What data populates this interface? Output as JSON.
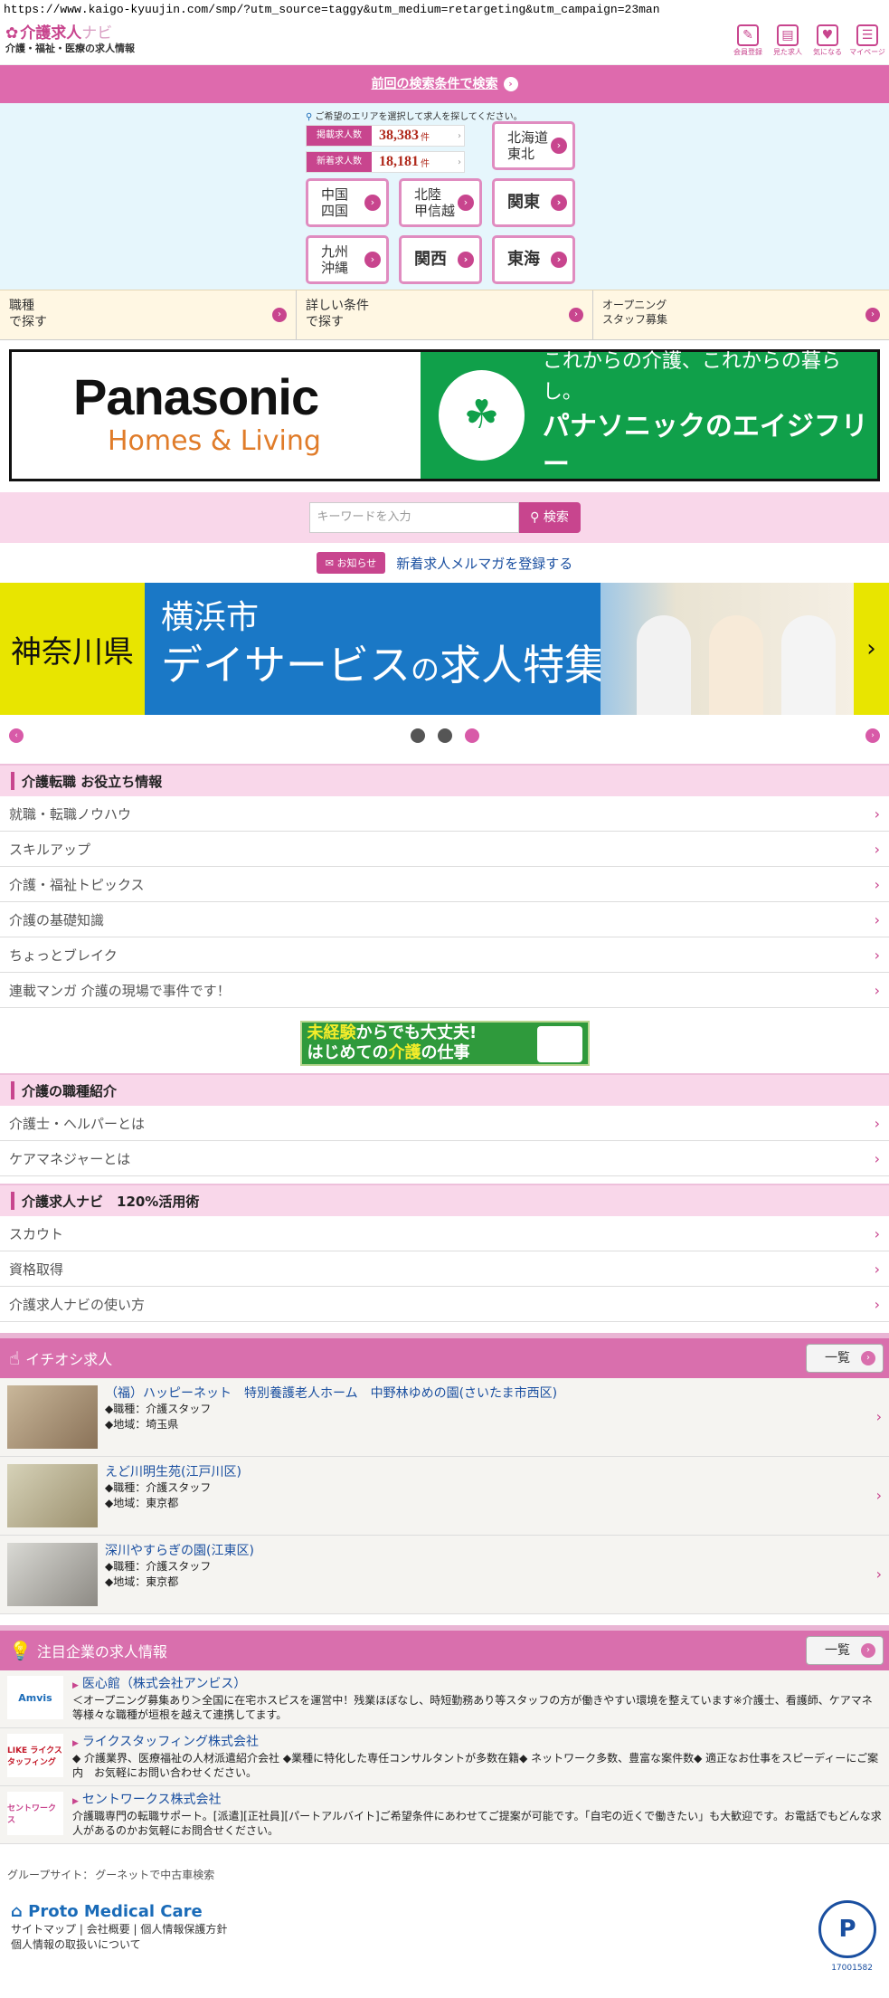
{
  "url": "https://www.kaigo-kyuujin.com/smp/?utm_source=taggy&utm_medium=retargeting&utm_campaign=23man",
  "header": {
    "logo_main": "介護求人",
    "logo_sub": "ナビ",
    "logo_tagline": "介護・福祉・医療の求人情報",
    "icons": [
      {
        "label": "会員登録",
        "icon": "pencil-icon"
      },
      {
        "label": "見た求人",
        "icon": "calendar-icon"
      },
      {
        "label": "気になる",
        "icon": "heart-icon"
      },
      {
        "label": "マイページ",
        "icon": "list-icon"
      }
    ]
  },
  "prev_search": "前回の検索条件で検索",
  "area": {
    "hint": "ご希望のエリアを選択して求人を探してください。",
    "stats": [
      {
        "label": "掲載求人数",
        "value": "38,383",
        "unit": "件"
      },
      {
        "label": "新着求人数",
        "value": "18,181",
        "unit": "件"
      }
    ],
    "regions": [
      "北海道\n東北",
      "中国\n四国",
      "北陸\n甲信越",
      "関東",
      "九州\n沖縄",
      "関西",
      "東海"
    ]
  },
  "search_tabs": [
    "職種\nで探す",
    "詳しい条件\nで探す",
    "オープニング\nスタッフ募集"
  ],
  "ad_banner": {
    "brand": "Panasonic",
    "brand_sub": "Homes & Living",
    "line1": "これからの介護、これからの暮らし。",
    "line2": "パナソニックのエイジフリー"
  },
  "keyword": {
    "placeholder": "キーワードを入力",
    "button": "検索"
  },
  "notice": {
    "tag": "お知らせ",
    "link": "新着求人メルマガを登録する"
  },
  "slide": {
    "left": "神奈川県",
    "title1": "横浜市",
    "title2a": "デイサービス",
    "title2b": "の",
    "title2c": "求人特集"
  },
  "sections": [
    {
      "title": "介護転職 お役立ち情報",
      "items": [
        "就職・転職ノウハウ",
        "スキルアップ",
        "介護・福祉トピックス",
        "介護の基礎知識",
        "ちょっとブレイク",
        "連載マンガ 介護の現場で事件です！"
      ]
    },
    {
      "title": "介護の職種紹介",
      "items": [
        "介護士・ヘルパーとは",
        "ケアマネジャーとは"
      ]
    },
    {
      "title": "介護求人ナビ　120%活用術",
      "items": [
        "スカウト",
        "資格取得",
        "介護求人ナビの使い方"
      ]
    }
  ],
  "mid_banner": {
    "a": "未経験",
    "b": "からでも大丈夫!",
    "c": "はじめての",
    "d": "介護",
    "e": "の仕事"
  },
  "pickup": {
    "title": "イチオシ求人",
    "all": "一覧",
    "jobs": [
      {
        "name": "（福）ハッピーネット　特別養護老人ホーム　中野林ゆめの園(さいたま市西区)",
        "role": "◆職種：介護スタッフ",
        "area": "◆地域：埼玉県"
      },
      {
        "name": "えど川明生苑(江戸川区)",
        "role": "◆職種：介護スタッフ",
        "area": "◆地域：東京都"
      },
      {
        "name": "深川やすらぎの園(江東区)",
        "role": "◆職種：介護スタッフ",
        "area": "◆地域：東京都"
      }
    ]
  },
  "featured": {
    "title": "注目企業の求人情報",
    "all": "一覧",
    "companies": [
      {
        "logo": "Amvis",
        "name": "医心館（株式会社アンビス）",
        "desc": "＜オープニング募集あり＞全国に在宅ホスピスを運営中！残業ほぼなし、時短勤務あり等スタッフの方が働きやすい環境を整えています※介護士、看護師、ケアマネ等様々な職種が垣根を越えて連携してます。"
      },
      {
        "logo": "LIKE ライクスタッフィング",
        "name": "ライクスタッフィング株式会社",
        "desc": "◆ 介護業界、医療福祉の人材派遣紹介会社 ◆業種に特化した専任コンサルタントが多数在籍◆ ネットワーク多数、豊富な案件数◆ 適正なお仕事をスピーディーにご案内　お気軽にお問い合わせください。"
      },
      {
        "logo": "セントワークス",
        "name": "セントワークス株式会社",
        "desc": "介護職専門の転職サポート。[派遣][正社員][パートアルバイト]ご希望条件にあわせてご提案が可能です。「自宅の近くで働きたい」も大歓迎です。お電話でもどんな求人があるのかお気軽にお問合せください。"
      }
    ]
  },
  "group_site": {
    "label": "グループサイト：",
    "link": "グーネットで中古車検索"
  },
  "footer": {
    "brand": "Proto Medical Care",
    "links": [
      "サイトマップ",
      "会社概要",
      "個人情報保護方針",
      "個人情報の取扱いについて"
    ],
    "privacy_number": "17001582"
  }
}
